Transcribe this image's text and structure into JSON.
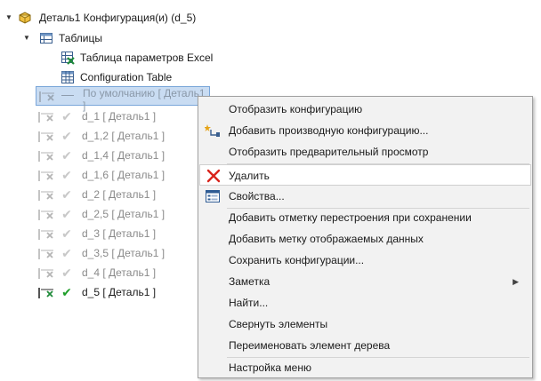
{
  "tree": {
    "root_label": "Деталь1 Конфигурация(и)  (d_5)",
    "tables_label": "Таблицы",
    "tables": [
      {
        "label": "Таблица параметров Excel",
        "icon": "excel-table-icon"
      },
      {
        "label": "Configuration Table",
        "icon": "configuration-table-icon"
      }
    ],
    "selected_config": "По умолчанию [ Деталь1 ]",
    "configs": [
      {
        "label": "d_1 [ Деталь1 ]"
      },
      {
        "label": "d_1,2 [ Деталь1 ]"
      },
      {
        "label": "d_1,4 [ Деталь1 ]"
      },
      {
        "label": "d_1,6 [ Деталь1 ]"
      },
      {
        "label": "d_2 [ Деталь1 ]"
      },
      {
        "label": "d_2,5 [ Деталь1 ]"
      },
      {
        "label": "d_3 [ Деталь1 ]"
      },
      {
        "label": "d_3,5 [ Деталь1 ]"
      },
      {
        "label": "d_4 [ Деталь1 ]"
      },
      {
        "label": "d_5 [ Деталь1 ]",
        "active": true
      }
    ]
  },
  "context_menu": {
    "items": [
      {
        "label": "Отобразить конфигурацию"
      },
      {
        "label": "Добавить производную конфигурацию...",
        "icon": "derived-config-icon"
      },
      {
        "label": "Отобразить предварительный просмотр"
      },
      {
        "label": "Удалить",
        "icon": "delete-icon",
        "hover": true
      },
      {
        "label": "Свойства...",
        "icon": "properties-icon"
      },
      {
        "label": "Добавить отметку перестроения при сохранении"
      },
      {
        "label": "Добавить метку отображаемых данных"
      },
      {
        "label": "Сохранить конфигурации..."
      },
      {
        "label": "Заметка",
        "submenu": true
      },
      {
        "label": "Найти..."
      },
      {
        "label": "Свернуть элементы"
      },
      {
        "label": "Переименовать элемент дерева"
      },
      {
        "label": "Настройка меню"
      }
    ]
  },
  "colors": {
    "selection": "#c9dcf2",
    "active_check": "#1f9e2a",
    "delete_red": "#d9241c",
    "menu_bg": "#f2f2f2"
  }
}
